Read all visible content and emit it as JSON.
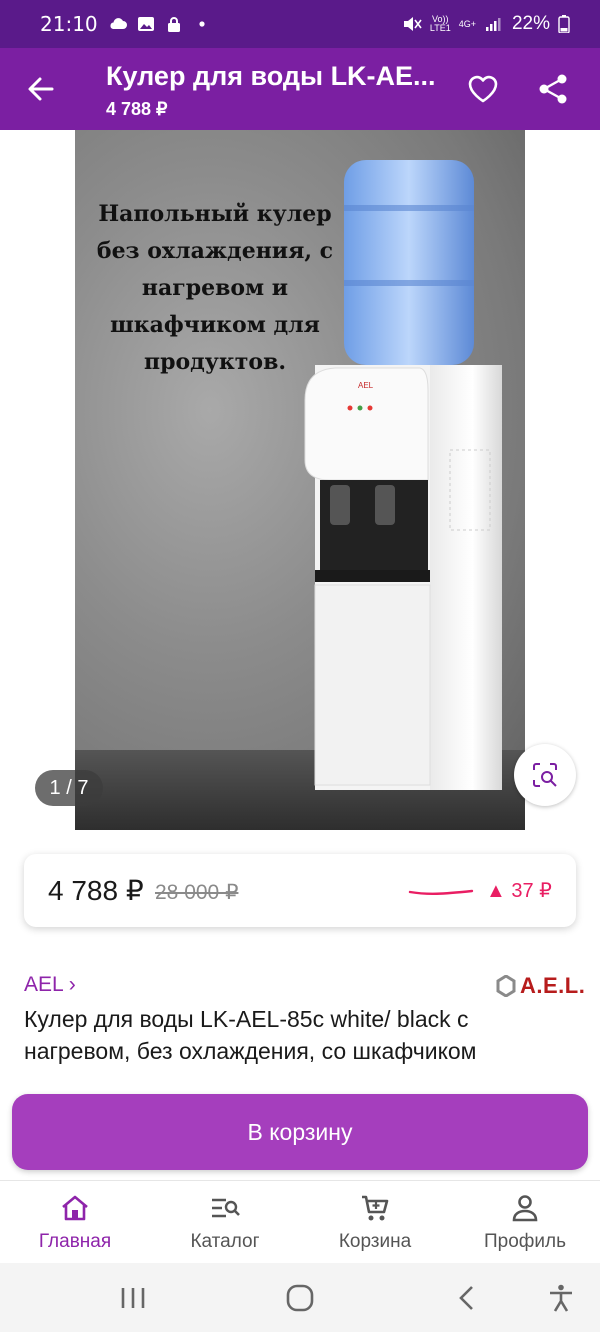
{
  "status_bar": {
    "time": "21:10",
    "network_top": "Vo))",
    "network_bottom": "LTE1",
    "data_type": "4G+",
    "battery": "22%"
  },
  "header": {
    "title": "Кулер для воды LK-AE...",
    "price": "4 788 ₽",
    "accent_color": "#7b1fa2"
  },
  "gallery": {
    "caption": "Напольный кулер без охлаждения, с нагревом и шкафчиком для продуктов.",
    "counter": "1 / 7",
    "photo_brand": "AEL"
  },
  "price_card": {
    "current": "4 788 ₽",
    "old": "28 000 ₽",
    "delta": "▲ 37 ₽",
    "delta_color": "#e91e63"
  },
  "product": {
    "brand_link": "AEL ›",
    "brand_logo": "A.E.L.",
    "name": "Кулер для воды LK-AEL-85c white/ black с нагревом, без охлаждения, со шкафчиком"
  },
  "cart_button": {
    "label": "В корзину",
    "color": "#a53ebd"
  },
  "bottom_nav": {
    "items": [
      {
        "label": "Главная",
        "icon": "home-icon",
        "active": true
      },
      {
        "label": "Каталог",
        "icon": "catalog-search-icon",
        "active": false
      },
      {
        "label": "Корзина",
        "icon": "cart-icon",
        "active": false
      },
      {
        "label": "Профиль",
        "icon": "profile-icon",
        "active": false
      }
    ]
  }
}
